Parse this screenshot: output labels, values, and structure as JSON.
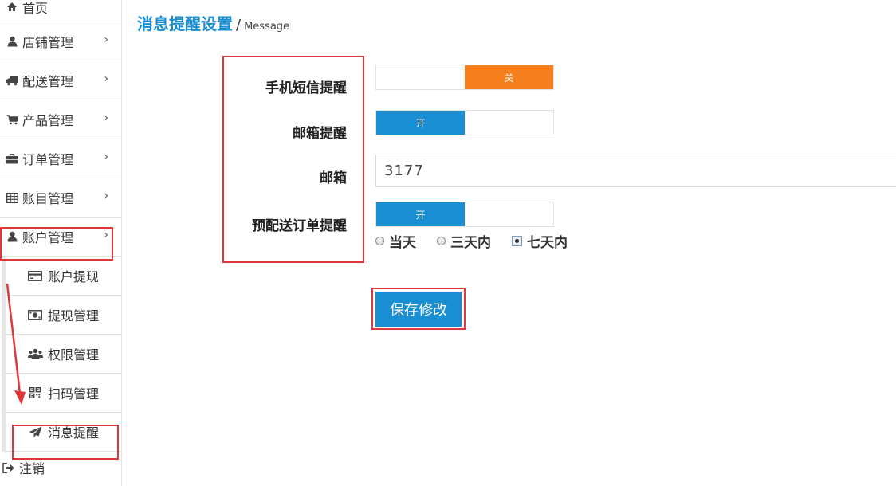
{
  "sidebar": {
    "items": [
      {
        "label": "首页",
        "icon": "home-icon"
      },
      {
        "label": "店铺管理",
        "icon": "user-icon",
        "chevron": "›"
      },
      {
        "label": "配送管理",
        "icon": "truck-icon",
        "chevron": "›"
      },
      {
        "label": "产品管理",
        "icon": "cart-icon",
        "chevron": "›"
      },
      {
        "label": "订单管理",
        "icon": "briefcase-icon",
        "chevron": "›"
      },
      {
        "label": "账目管理",
        "icon": "table-icon",
        "chevron": "›"
      },
      {
        "label": "账户管理",
        "icon": "user-icon",
        "chevron": "›"
      }
    ],
    "subitems": [
      {
        "label": "账户提现",
        "icon": "credit-card-icon"
      },
      {
        "label": "提现管理",
        "icon": "money-icon"
      },
      {
        "label": "权限管理",
        "icon": "users-icon"
      },
      {
        "label": "扫码管理",
        "icon": "qrcode-icon"
      },
      {
        "label": "消息提醒",
        "icon": "paper-plane-icon"
      }
    ],
    "logout": {
      "label": "注销",
      "icon": "sign-out-icon"
    }
  },
  "page": {
    "title": "消息提醒设置",
    "separator": "/",
    "subtitle": "Message"
  },
  "form": {
    "sms_label": "手机短信提醒",
    "sms_toggle": "关",
    "email_notify_label": "邮箱提醒",
    "email_notify_toggle": "开",
    "email_label": "邮箱",
    "email_value": "3177",
    "delivery_label": "预配送订单提醒",
    "delivery_toggle": "开",
    "radio_options": [
      "当天",
      "三天内",
      "七天内"
    ],
    "radio_selected": "七天内",
    "save_label": "保存修改"
  },
  "colors": {
    "accent": "#1a8ed3",
    "off": "#f57f1d",
    "annotation": "#e0383a"
  }
}
